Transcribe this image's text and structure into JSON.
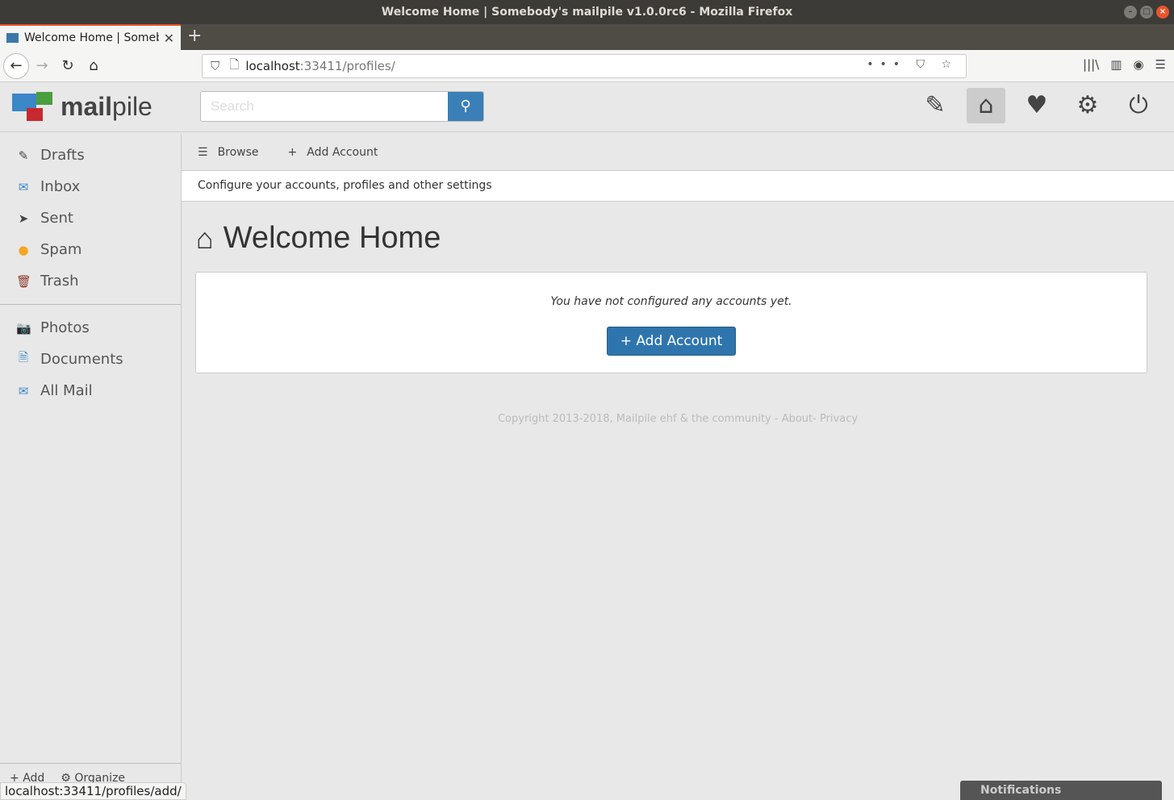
{
  "window": {
    "title": "Welcome Home | Somebody's mailpile v1.0.0rc6 - Mozilla Firefox"
  },
  "browser": {
    "tab_title": "Welcome Home | Somebody's mailpile",
    "url_host": "localhost",
    "url_rest": ":33411/profiles/",
    "status_url": "localhost:33411/profiles/add/"
  },
  "app": {
    "logo_bold": "mail",
    "logo_rest": "pile",
    "search_placeholder": "Search"
  },
  "sidebar": {
    "items": [
      {
        "label": "Drafts",
        "icon": "✎",
        "color": "#444444"
      },
      {
        "label": "Inbox",
        "icon": "✉",
        "color": "#3b87c7"
      },
      {
        "label": "Sent",
        "icon": "➤",
        "color": "#444444"
      },
      {
        "label": "Spam",
        "icon": "●",
        "color": "#f5a623"
      },
      {
        "label": "Trash",
        "icon": "🗑",
        "color": "#8b3a2a"
      }
    ],
    "tags": [
      {
        "label": "Photos",
        "icon": "📷",
        "color": "#4a9e3f"
      },
      {
        "label": "Documents",
        "icon": "🗎",
        "color": "#3b87c7"
      },
      {
        "label": "All Mail",
        "icon": "✉",
        "color": "#3b87c7"
      }
    ],
    "footer": {
      "add": "Add",
      "organize": "Organize"
    }
  },
  "subnav": {
    "browse": "Browse",
    "add_account": "Add Account"
  },
  "main": {
    "description": "Configure your accounts, profiles and other settings",
    "title": "Welcome Home",
    "empty_message": "You have not configured any accounts yet.",
    "add_button": "Add Account"
  },
  "footer": {
    "text": "Copyright 2013-2018, Mailpile ehf & the community - About- Privacy"
  },
  "notifications": "Notifications"
}
